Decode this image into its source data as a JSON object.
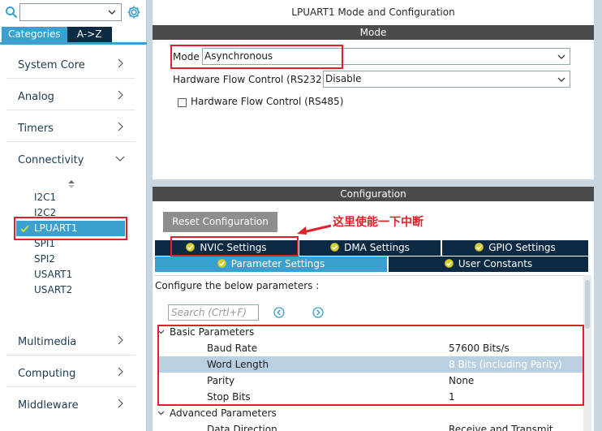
{
  "left": {
    "search": {
      "value": ""
    },
    "tabs": {
      "categories": "Categories",
      "az": "A->Z"
    },
    "categories": {
      "system_core": "System Core",
      "analog": "Analog",
      "timers": "Timers",
      "connectivity": "Connectivity",
      "multimedia": "Multimedia",
      "computing": "Computing",
      "middleware": "Middleware"
    },
    "peripherals": {
      "i2c1": "I2C1",
      "i2c2": "I2C2",
      "lpuart1": "LPUART1",
      "spi1": "SPI1",
      "spi2": "SPI2",
      "usart1": "USART1",
      "usart2": "USART2"
    }
  },
  "right": {
    "title": "LPUART1 Mode and Configuration",
    "mode": {
      "header": "Mode",
      "mode_label": "Mode",
      "mode_value": "Asynchronous",
      "hfc_label": "Hardware Flow Control (RS232)",
      "hfc_value": "Disable",
      "rs485_label": "Hardware Flow Control (RS485)"
    },
    "config": {
      "header": "Configuration",
      "reset_label": "Reset Configuration",
      "tabs": {
        "nvic": "NVIC Settings",
        "dma": "DMA Settings",
        "gpio": "GPIO Settings",
        "params": "Parameter Settings",
        "user": "User Constants"
      },
      "instructions": "Configure the below parameters :",
      "search_placeholder": "Search (Crtl+F)",
      "basic_group": "Basic Parameters",
      "params": [
        {
          "name": "Baud Rate",
          "value": "57600 Bits/s"
        },
        {
          "name": "Word Length",
          "value": "8 Bits (including Parity)"
        },
        {
          "name": "Parity",
          "value": "None"
        },
        {
          "name": "Stop Bits",
          "value": "1"
        }
      ],
      "advanced_group": "Advanced Parameters",
      "advanced_params": [
        {
          "name": "Data Direction",
          "value": "Receive and Transmit"
        }
      ]
    }
  },
  "annotation": {
    "text": "这里使能一下中断"
  },
  "colors": {
    "accent": "#3aa0d0",
    "dark_navy": "#0d2a45",
    "header_gray": "#4b4b4b",
    "highlight": "#e0212b",
    "ok_green": "#d6cc2b"
  }
}
